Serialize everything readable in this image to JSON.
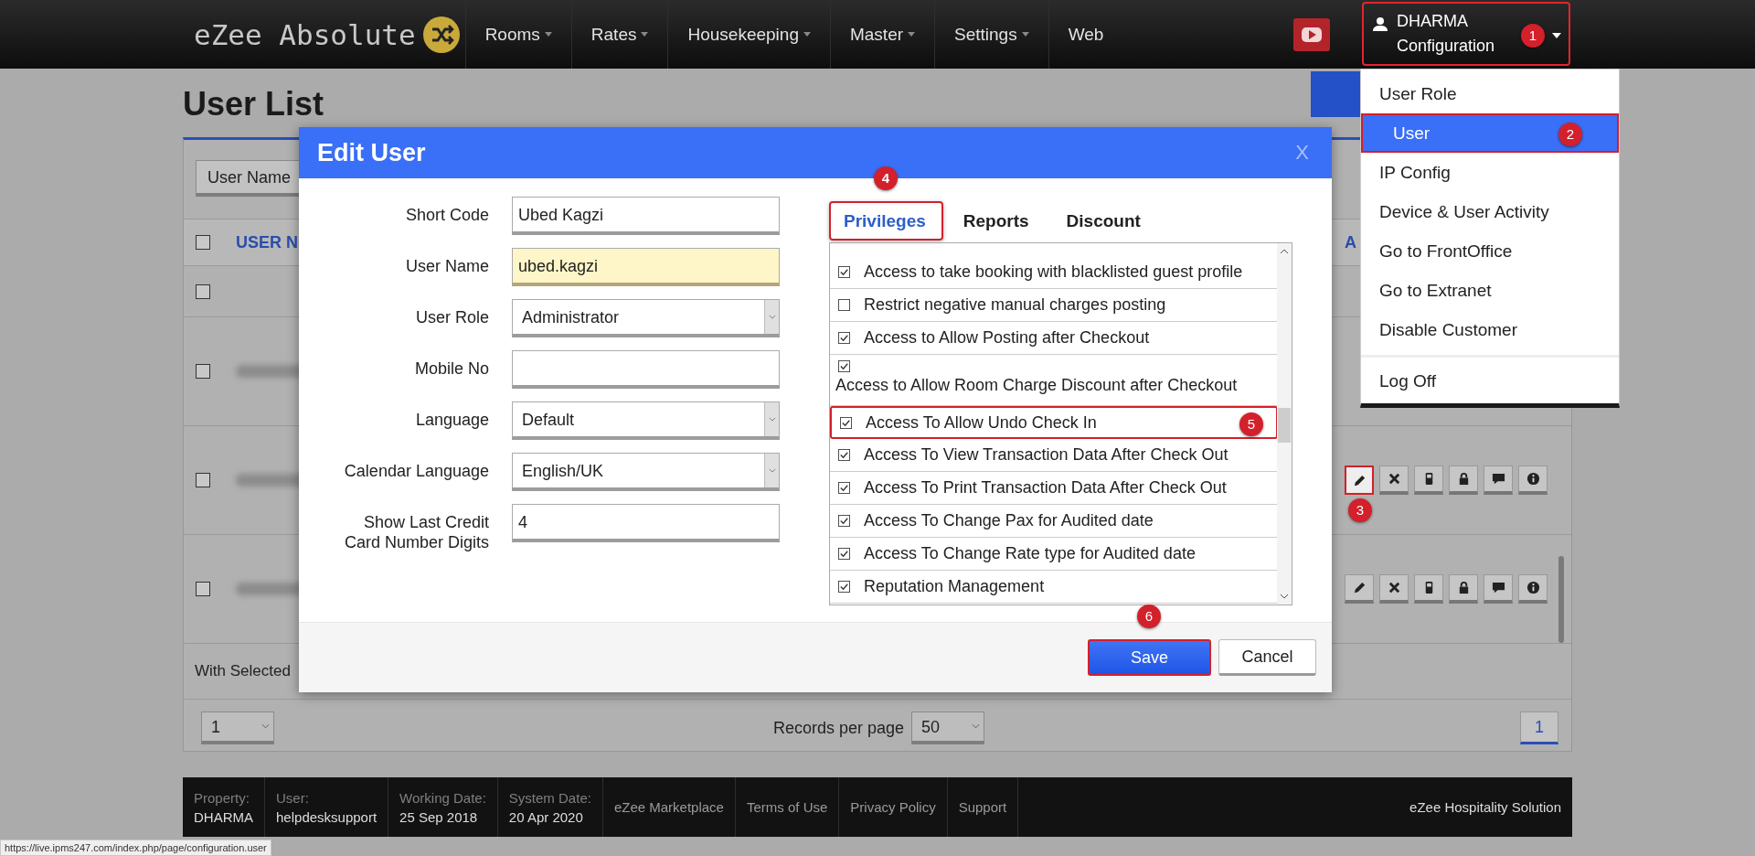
{
  "navbar": {
    "logo": "eZee Absolute",
    "menu": [
      {
        "label": "Rooms",
        "dropdown": true
      },
      {
        "label": "Rates",
        "dropdown": true
      },
      {
        "label": "Housekeeping",
        "dropdown": true
      },
      {
        "label": "Master",
        "dropdown": true
      },
      {
        "label": "Settings",
        "dropdown": true
      },
      {
        "label": "Web",
        "dropdown": false
      }
    ],
    "user": {
      "name": "DHARMA",
      "section": "Configuration",
      "highlighted": true,
      "badge": "1"
    }
  },
  "user_menu": {
    "items": [
      {
        "label": "User Role",
        "selected": false
      },
      {
        "label": "User",
        "selected": true,
        "highlighted": true,
        "badge": "2"
      },
      {
        "label": "IP Config",
        "selected": false
      },
      {
        "label": "Device & User Activity",
        "selected": false
      },
      {
        "label": "Go to FrontOffice",
        "selected": false
      },
      {
        "label": "Go to Extranet",
        "selected": false
      },
      {
        "label": "Disable Customer",
        "selected": false
      }
    ],
    "bottom_items": [
      {
        "label": "Log Off",
        "selected": false
      }
    ]
  },
  "page": {
    "title": "User List",
    "filter": "User Name",
    "select_all": {
      "checked": false
    },
    "columns": [
      "USER N",
      "A"
    ],
    "rows": [
      {
        "checked": false,
        "blurred_name": false
      },
      {
        "checked": false,
        "blurred_name": true
      },
      {
        "checked": false,
        "blurred_name": true,
        "actions": [
          {
            "kind": "edit",
            "highlighted": true,
            "badge": "3"
          },
          {
            "kind": "delete",
            "highlighted": false
          },
          {
            "kind": "mobile",
            "highlighted": false
          },
          {
            "kind": "lock",
            "highlighted": false
          },
          {
            "kind": "comment",
            "highlighted": false
          },
          {
            "kind": "info",
            "highlighted": false
          }
        ]
      },
      {
        "checked": false,
        "blurred_name": true,
        "actions": [
          {
            "kind": "edit",
            "highlighted": false
          },
          {
            "kind": "delete",
            "highlighted": false
          },
          {
            "kind": "mobile",
            "highlighted": false
          },
          {
            "kind": "lock",
            "highlighted": false
          },
          {
            "kind": "comment",
            "highlighted": false
          },
          {
            "kind": "info",
            "highlighted": false
          }
        ]
      }
    ],
    "with_selected": "With Selected",
    "pager": {
      "page_select": "1",
      "records_label": "Records per page",
      "records_value": "50",
      "current_page": "1"
    }
  },
  "modal": {
    "title": "Edit User",
    "close": "X",
    "fields": [
      {
        "label": "Short Code",
        "value": "Ubed Kagzi",
        "kind": "text",
        "highlighted": false
      },
      {
        "label": "User Name",
        "value": "ubed.kagzi",
        "kind": "text",
        "highlighted": true
      },
      {
        "label": "User Role",
        "value": "Administrator",
        "kind": "select",
        "highlighted": false
      },
      {
        "label": "Mobile No",
        "kind": "text",
        "highlighted": false
      },
      {
        "label": "Language",
        "value": "Default",
        "kind": "select",
        "highlighted": false
      },
      {
        "label": "Calendar Language",
        "value": "English/UK",
        "kind": "select",
        "highlighted": false
      },
      {
        "label": "Show Last Credit Card Number Digits",
        "value": "4",
        "kind": "text",
        "highlighted": false
      }
    ],
    "tabs": [
      {
        "label": "Privileges",
        "selected": true,
        "highlighted": true,
        "badge": "4"
      },
      {
        "label": "Reports",
        "selected": false,
        "highlighted": false
      },
      {
        "label": "Discount",
        "selected": false,
        "highlighted": false
      }
    ],
    "privileges": [
      {
        "label": "Access to take booking with blacklisted guest profile",
        "checked": true,
        "kind": "inline",
        "highlighted": false
      },
      {
        "label": "Restrict negative manual charges posting",
        "checked": false,
        "kind": "inline",
        "highlighted": false
      },
      {
        "label": "Access to Allow Posting after Checkout",
        "checked": true,
        "kind": "inline",
        "highlighted": false
      },
      {
        "label": "Access to Allow Room Charge Discount after Checkout",
        "checked": true,
        "kind": "wrapped",
        "highlighted": false
      },
      {
        "label": "Access To Allow Undo Check In",
        "checked": true,
        "kind": "inline",
        "highlighted": true,
        "badge": "5"
      },
      {
        "label": "Access To View Transaction Data After Check Out",
        "checked": true,
        "kind": "inline",
        "highlighted": false
      },
      {
        "label": "Access To Print Transaction Data After Check Out",
        "checked": true,
        "kind": "inline",
        "highlighted": false
      },
      {
        "label": "Access To Change Pax for Audited date",
        "checked": true,
        "kind": "inline",
        "highlighted": false
      },
      {
        "label": "Access To Change Rate type for Audited date",
        "checked": true,
        "kind": "inline",
        "highlighted": false
      },
      {
        "label": "Reputation Management",
        "checked": true,
        "kind": "inline",
        "highlighted": false
      }
    ],
    "buttons": [
      {
        "label": "Save",
        "kind": "primary",
        "highlighted": true,
        "badge": "6"
      },
      {
        "label": "Cancel",
        "kind": "default",
        "highlighted": false
      }
    ]
  },
  "footer": {
    "info": [
      {
        "label": "Property:",
        "value": "DHARMA"
      },
      {
        "label": "User:",
        "value": "helpdesksupport"
      },
      {
        "label": "Working Date:",
        "value": "25 Sep 2018"
      },
      {
        "label": "System Date:",
        "value": "20 Apr 2020"
      }
    ],
    "links": [
      "eZee Marketplace",
      "Terms of Use",
      "Privacy Policy",
      "Support"
    ],
    "brand": "eZee Hospitality Solution"
  },
  "status_url": "https://live.ipms247.com/index.php/page/configuration.user"
}
